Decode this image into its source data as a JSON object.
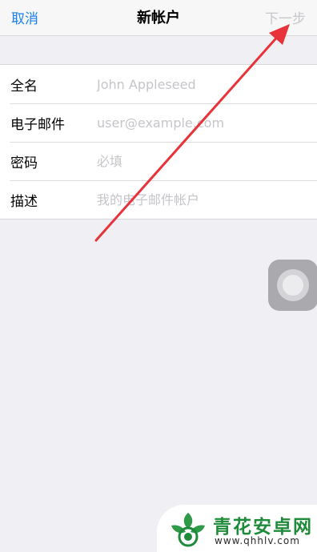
{
  "navbar": {
    "cancel_label": "取消",
    "title": "新帐户",
    "next_label": "下一步"
  },
  "form": {
    "fields": [
      {
        "label": "全名",
        "value": "",
        "placeholder": "John Appleseed"
      },
      {
        "label": "电子邮件",
        "value": "",
        "placeholder": "user@example.com"
      },
      {
        "label": "密码",
        "value": "",
        "placeholder": "必填"
      },
      {
        "label": "描述",
        "value": "",
        "placeholder": "我的电子邮件帐户"
      }
    ]
  },
  "assistive_touch": {
    "icon": "assistive-touch-icon"
  },
  "annotation": {
    "color": "#e8333a",
    "icon": "red-arrow-icon"
  },
  "watermark": {
    "name": "青花安卓网",
    "url": "www.qhhlv.com",
    "icon": "qinghua-logo-icon"
  },
  "colors": {
    "accent": "#1a7ff5",
    "disabled": "#c7c7cc",
    "background": "#efeff4"
  }
}
